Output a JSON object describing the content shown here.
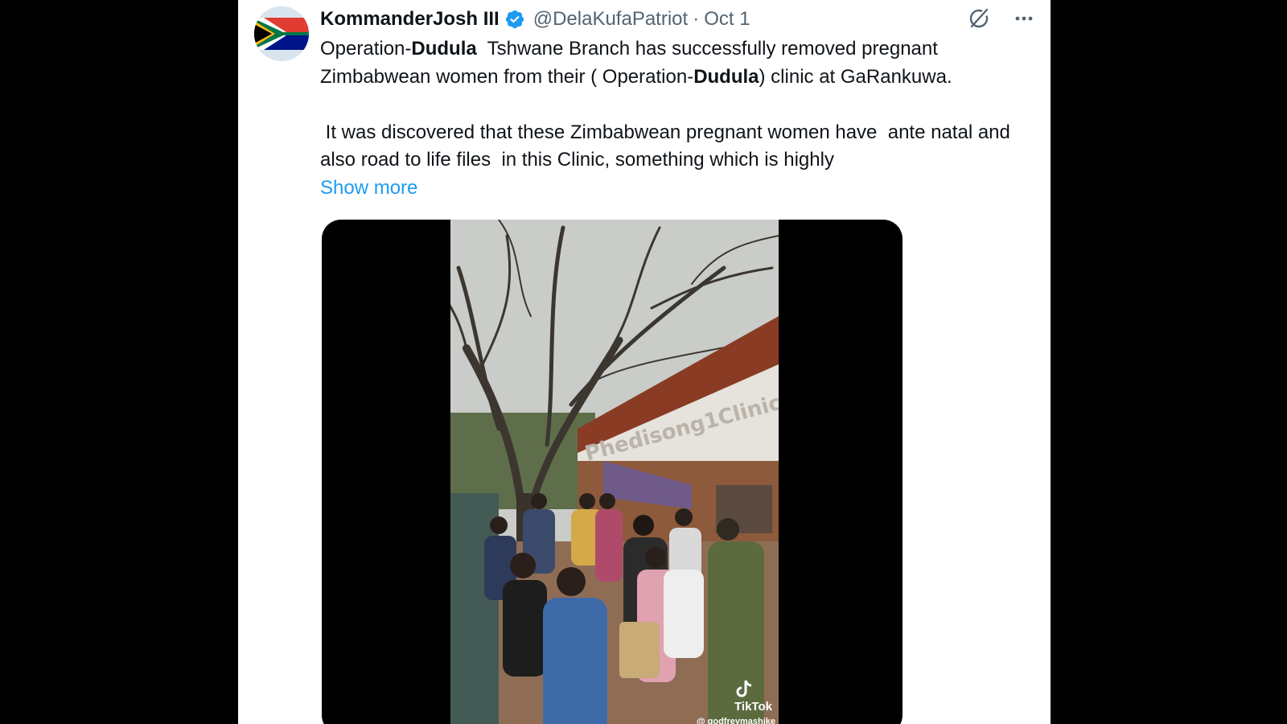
{
  "tweet": {
    "author": {
      "display_name": "KommanderJosh III",
      "handle": "@DelaKufaPatriot",
      "separator": "·",
      "date": "Oct 1"
    },
    "text": {
      "p1_part1": "Operation-",
      "p1_bold1": "Dudula",
      "p1_part2": "  Tshwane Branch has successfully removed pregnant Zimbabwean women from their ( Operation-",
      "p1_bold2": "Dudula",
      "p1_part3": ") clinic at GaRankuwa.",
      "p2": " It was discovered that these Zimbabwean pregnant women have  ante natal and also road to life files  in this Clinic, something which is highly",
      "show_more": "Show more"
    },
    "media": {
      "clinic_sign": "Phedisong1Clinic",
      "watermark_brand": "TikTok",
      "watermark_user": "@ godfreymashike"
    },
    "icons": {
      "verified": "verified-badge-icon",
      "grok": "grok-icon",
      "more": "more-options-icon",
      "tiktok": "tiktok-icon"
    },
    "colors": {
      "accent": "#1d9bf0",
      "text": "#0f1419",
      "secondary": "#536471",
      "background": "#ffffff"
    }
  }
}
